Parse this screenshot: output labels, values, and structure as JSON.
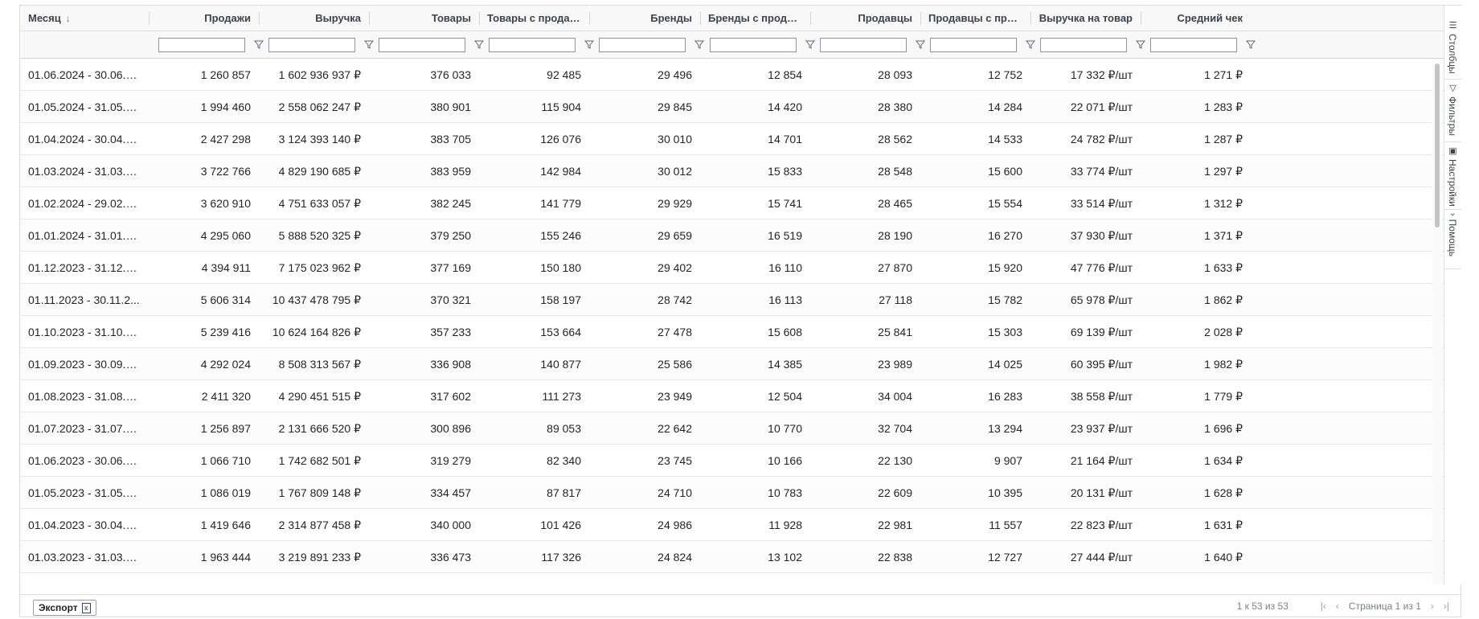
{
  "columns": [
    {
      "label": "Месяц",
      "sorted": "desc"
    },
    {
      "label": "Продажи"
    },
    {
      "label": "Выручка"
    },
    {
      "label": "Товары"
    },
    {
      "label": "Товары с продажами"
    },
    {
      "label": "Бренды"
    },
    {
      "label": "Бренды с продажа..."
    },
    {
      "label": "Продавцы"
    },
    {
      "label": "Продавцы с прода..."
    },
    {
      "label": "Выручка на товар"
    },
    {
      "label": "Средний чек"
    }
  ],
  "rows": [
    [
      "01.06.2024 - 30.06.2...",
      "1 260 857",
      "1 602 936 937 ₽",
      "376 033",
      "92 485",
      "29 496",
      "12 854",
      "28 093",
      "12 752",
      "17 332 ₽/шт",
      "1 271 ₽"
    ],
    [
      "01.05.2024 - 31.05.2...",
      "1 994 460",
      "2 558 062 247 ₽",
      "380 901",
      "115 904",
      "29 845",
      "14 420",
      "28 380",
      "14 284",
      "22 071 ₽/шт",
      "1 283 ₽"
    ],
    [
      "01.04.2024 - 30.04.2...",
      "2 427 298",
      "3 124 393 140 ₽",
      "383 705",
      "126 076",
      "30 010",
      "14 701",
      "28 562",
      "14 533",
      "24 782 ₽/шт",
      "1 287 ₽"
    ],
    [
      "01.03.2024 - 31.03.2...",
      "3 722 766",
      "4 829 190 685 ₽",
      "383 959",
      "142 984",
      "30 012",
      "15 833",
      "28 548",
      "15 600",
      "33 774 ₽/шт",
      "1 297 ₽"
    ],
    [
      "01.02.2024 - 29.02.2...",
      "3 620 910",
      "4 751 633 057 ₽",
      "382 245",
      "141 779",
      "29 929",
      "15 741",
      "28 465",
      "15 554",
      "33 514 ₽/шт",
      "1 312 ₽"
    ],
    [
      "01.01.2024 - 31.01.2...",
      "4 295 060",
      "5 888 520 325 ₽",
      "379 250",
      "155 246",
      "29 659",
      "16 519",
      "28 190",
      "16 270",
      "37 930 ₽/шт",
      "1 371 ₽"
    ],
    [
      "01.12.2023 - 31.12.2...",
      "4 394 911",
      "7 175 023 962 ₽",
      "377 169",
      "150 180",
      "29 402",
      "16 110",
      "27 870",
      "15 920",
      "47 776 ₽/шт",
      "1 633 ₽"
    ],
    [
      "01.11.2023 - 30.11.2...",
      "5 606 314",
      "10 437 478 795 ₽",
      "370 321",
      "158 197",
      "28 742",
      "16 113",
      "27 118",
      "15 782",
      "65 978 ₽/шт",
      "1 862 ₽"
    ],
    [
      "01.10.2023 - 31.10.2...",
      "5 239 416",
      "10 624 164 826 ₽",
      "357 233",
      "153 664",
      "27 478",
      "15 608",
      "25 841",
      "15 303",
      "69 139 ₽/шт",
      "2 028 ₽"
    ],
    [
      "01.09.2023 - 30.09.2...",
      "4 292 024",
      "8 508 313 567 ₽",
      "336 908",
      "140 877",
      "25 586",
      "14 385",
      "23 989",
      "14 025",
      "60 395 ₽/шт",
      "1 982 ₽"
    ],
    [
      "01.08.2023 - 31.08.2...",
      "2 411 320",
      "4 290 451 515 ₽",
      "317 602",
      "111 273",
      "23 949",
      "12 504",
      "34 004",
      "16 283",
      "38 558 ₽/шт",
      "1 779 ₽"
    ],
    [
      "01.07.2023 - 31.07.2...",
      "1 256 897",
      "2 131 666 520 ₽",
      "300 896",
      "89 053",
      "22 642",
      "10 770",
      "32 704",
      "13 294",
      "23 937 ₽/шт",
      "1 696 ₽"
    ],
    [
      "01.06.2023 - 30.06.2...",
      "1 066 710",
      "1 742 682 501 ₽",
      "319 279",
      "82 340",
      "23 745",
      "10 166",
      "22 130",
      "9 907",
      "21 164 ₽/шт",
      "1 634 ₽"
    ],
    [
      "01.05.2023 - 31.05.2...",
      "1 086 019",
      "1 767 809 148 ₽",
      "334 457",
      "87 817",
      "24 710",
      "10 783",
      "22 609",
      "10 395",
      "20 131 ₽/шт",
      "1 628 ₽"
    ],
    [
      "01.04.2023 - 30.04.2...",
      "1 419 646",
      "2 314 877 458 ₽",
      "340 000",
      "101 426",
      "24 986",
      "11 928",
      "22 981",
      "11 557",
      "22 823 ₽/шт",
      "1 631 ₽"
    ],
    [
      "01.03.2023 - 31.03.2...",
      "1 963 444",
      "3 219 891 233 ₽",
      "336 473",
      "117 326",
      "24 824",
      "13 102",
      "22 838",
      "12 727",
      "27 444 ₽/шт",
      "1 640 ₽"
    ]
  ],
  "side_panel": {
    "columns_label": "Столбцы",
    "filters_label": "Фильтры",
    "settings_label": "Настройки",
    "help_label": "Помощь",
    "columns_icon": "columns-icon",
    "filters_icon": "funnel-icon",
    "settings_icon": "settings-icon",
    "help_icon": "chevron-icon"
  },
  "footer": {
    "export_label": "Экспорт",
    "export_icon": "excel-icon",
    "range_text": "1 к 53 из 53",
    "page_text": "Страница 1 из 1"
  },
  "colors": {
    "header_bg": "#f8f8f8",
    "border": "#dde2e6",
    "scroll_thumb": "#c4c4c4"
  }
}
